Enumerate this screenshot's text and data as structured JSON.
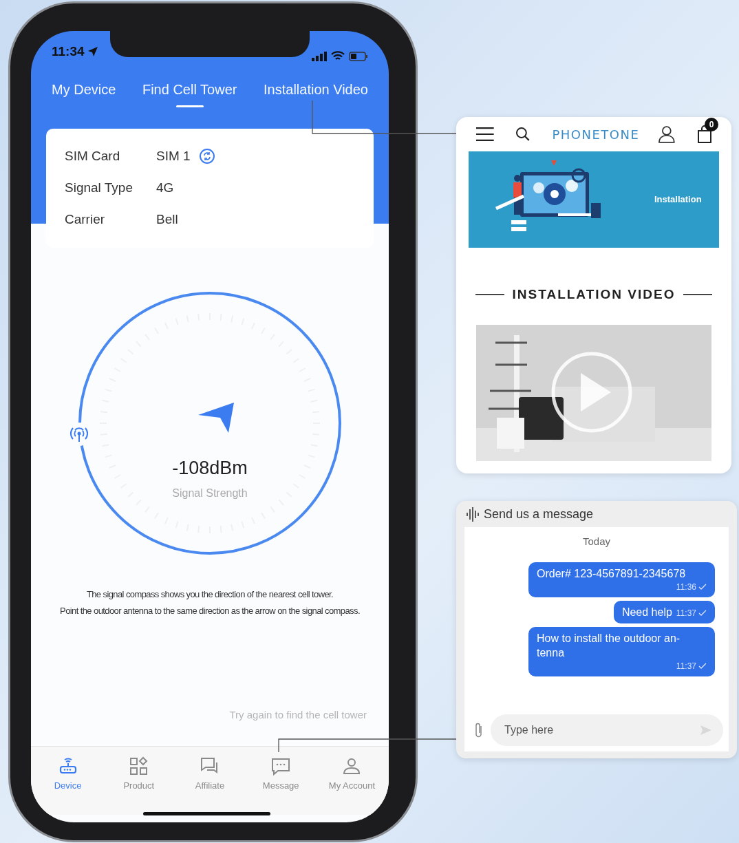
{
  "status_bar": {
    "time": "11:34"
  },
  "tabs": [
    {
      "label": "My Device",
      "selected": false
    },
    {
      "label": "Find Cell Tower",
      "selected": true
    },
    {
      "label": "Installation Video",
      "selected": false
    }
  ],
  "sim_info": [
    {
      "label": "SIM Card",
      "value": "SIM 1",
      "kind": "switchable"
    },
    {
      "label": "Signal Type",
      "value": "4G",
      "kind": "plain"
    },
    {
      "label": "Carrier",
      "value": "Bell",
      "kind": "plain"
    }
  ],
  "compass": {
    "reading": "-108dBm",
    "caption": "Signal Strength"
  },
  "description": [
    "The signal compass shows you the direction of the nearest cell tower.",
    "Point the outdoor antenna to the same direction as the arrow on the signal compass."
  ],
  "retry_link": "Try again to find the cell tower",
  "bottom_nav": [
    {
      "label": "Device",
      "selected": true
    },
    {
      "label": "Product",
      "selected": false
    },
    {
      "label": "Affiliate",
      "selected": false
    },
    {
      "label": "Message",
      "selected": false
    },
    {
      "label": "My Account",
      "selected": false
    }
  ],
  "web_panel": {
    "logo": "PHONETONE",
    "cart_count": "0",
    "banner": {
      "text": "Installation"
    },
    "section_title": "INSTALLATION VIDEO"
  },
  "chat_panel": {
    "title": "Send us a message",
    "date": "Today",
    "messages": [
      {
        "text": "Order# 123-4567891-2345678",
        "time": "11:36"
      },
      {
        "text": "Need help",
        "time": "11:37"
      },
      {
        "text": "How to install the outdoor an-tenna",
        "time": "11:37"
      }
    ],
    "input": {
      "placeholder": "Type here"
    }
  }
}
